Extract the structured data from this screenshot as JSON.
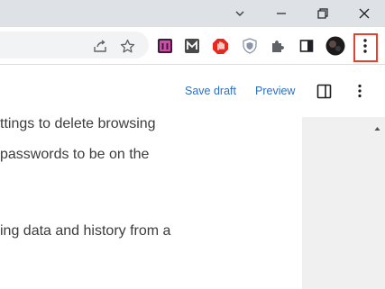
{
  "window_controls": {
    "chevron_icon": "chevron-down-icon",
    "minimize_icon": "minimize-icon",
    "restore_icon": "restore-icon",
    "close_icon": "close-icon"
  },
  "toolbar": {
    "share_icon": "share-icon",
    "bookmark_icon": "star-icon",
    "extensions": [
      "purple-extension-icon",
      "m-extension-icon",
      "red-hand-extension-icon",
      "shield-extension-icon",
      "puzzle-icon"
    ],
    "side_panel_icon": "side-panel-icon",
    "profile_icon": "avatar",
    "menu_icon": "kebab-menu-icon"
  },
  "editor": {
    "save_draft": "Save draft",
    "preview": "Preview",
    "settings_icon": "panel-toggle-icon",
    "options_icon": "options-icon"
  },
  "content": {
    "line1": "ttings to delete browsing",
    "line2": " passwords to be on the",
    "line3": "ing data and history from a"
  },
  "colors": {
    "accent_link": "#2f6fbf",
    "highlight_border": "#e8402f",
    "titlebar": "#dee1e6"
  }
}
